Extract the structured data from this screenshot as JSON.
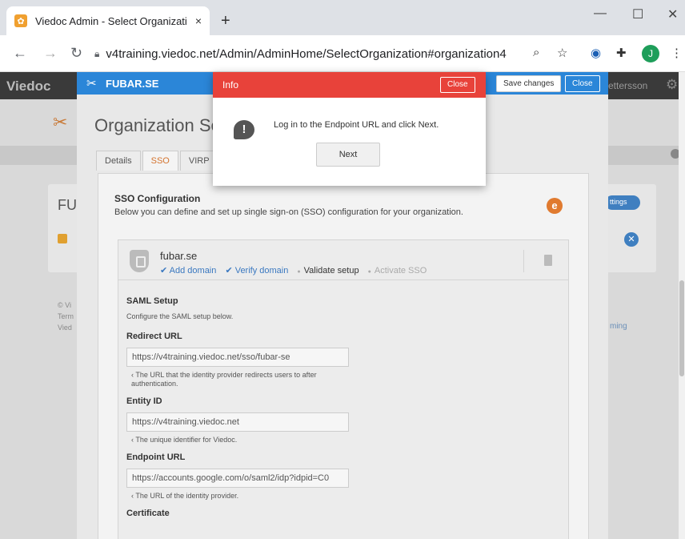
{
  "browser": {
    "tab_title": "Viedoc Admin - Select Organizati",
    "tab_close": "×",
    "new_tab": "+",
    "url_host": "v4training.viedoc.net",
    "url_path": "/Admin/AdminHome/SelectOrganization#organization4",
    "profile_initial": "J",
    "win_min": "—",
    "win_max": "☐",
    "win_close": "✕"
  },
  "app": {
    "logo": "Viedoc",
    "user": "ettersson",
    "bg_fu": "FU",
    "bg_tings": "ttings",
    "bg_footer": [
      "© Vi",
      "Term",
      "Vied"
    ],
    "bg_ming": "ming"
  },
  "org_dialog": {
    "org_name": "FUBAR.SE",
    "save_label": "Save changes",
    "close_label": "Close",
    "title": "Organization Se",
    "tabs": [
      "Details",
      "SSO",
      "VIRP"
    ],
    "sso": {
      "heading": "SSO Configuration",
      "description": "Below you can define and set up single sign-on (SSO) configuration for your organization.",
      "domain": "fubar.se",
      "steps": {
        "add": "✔ Add domain",
        "verify": "✔ Verify domain",
        "validate": "Validate setup",
        "activate": "Activate SSO"
      },
      "saml_heading": "SAML Setup",
      "saml_sub": "Configure the SAML setup below.",
      "redirect_label": "Redirect URL",
      "redirect_value": "https://v4training.viedoc.net/sso/fubar-se",
      "redirect_help": "The URL that the identity provider redirects users to after authentication.",
      "entity_label": "Entity ID",
      "entity_value": "https://v4training.viedoc.net",
      "entity_help": "The unique identifier for Viedoc.",
      "endpoint_label": "Endpoint URL",
      "endpoint_value": "https://accounts.google.com/o/saml2/idp?idpid=C0",
      "endpoint_help": "The URL of the identity provider.",
      "certificate_label": "Certificate"
    }
  },
  "info_modal": {
    "title": "Info",
    "close_label": "Close",
    "message": "Log in to the Endpoint URL and click Next.",
    "next_label": "Next"
  },
  "colors": {
    "accent_blue": "#2b86d8",
    "modal_red": "#e8423a",
    "viedoc_orange": "#e07a2f"
  }
}
